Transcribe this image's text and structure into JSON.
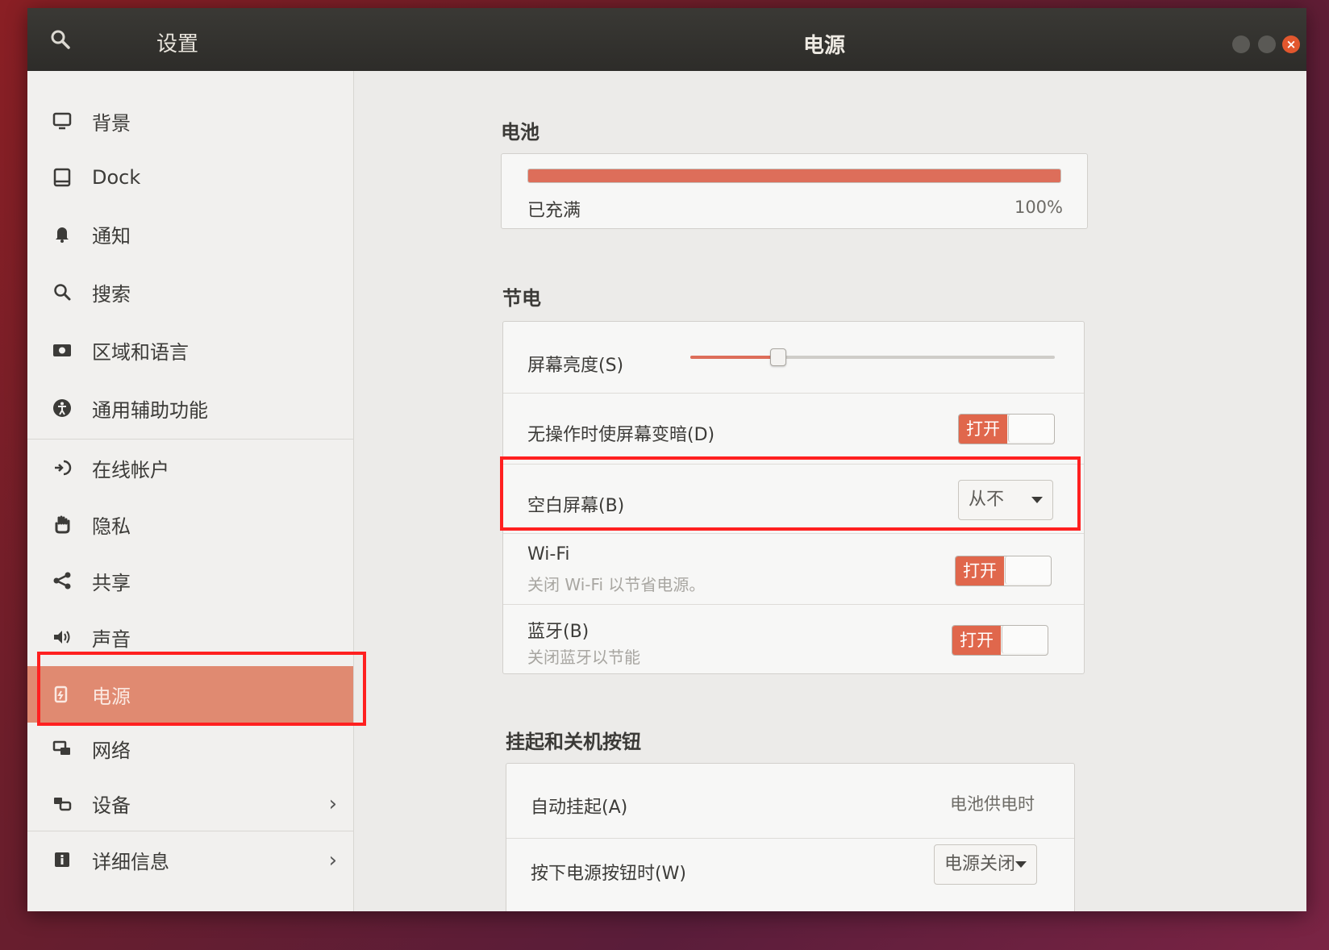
{
  "titlebar": {
    "search_icon": "search-icon",
    "left_title": "设置",
    "center_title": "电源"
  },
  "sidebar": {
    "items": [
      {
        "label": "背景",
        "icon": "display-icon"
      },
      {
        "label": "Dock",
        "icon": "dock-icon"
      },
      {
        "label": "通知",
        "icon": "bell-icon"
      },
      {
        "label": "搜索",
        "icon": "search-icon"
      },
      {
        "label": "区域和语言",
        "icon": "camera-icon"
      },
      {
        "label": "通用辅助功能",
        "icon": "accessibility-icon"
      },
      {
        "label": "在线帐户",
        "icon": "online-accounts-icon"
      },
      {
        "label": "隐私",
        "icon": "hand-icon"
      },
      {
        "label": "共享",
        "icon": "share-icon"
      },
      {
        "label": "声音",
        "icon": "speaker-icon"
      },
      {
        "label": "电源",
        "icon": "power-icon",
        "active": true
      },
      {
        "label": "网络",
        "icon": "network-icon"
      },
      {
        "label": "设备",
        "icon": "devices-icon",
        "chevron": "›"
      },
      {
        "label": "详细信息",
        "icon": "info-icon",
        "chevron": "›"
      }
    ]
  },
  "battery": {
    "section_title": "电池",
    "status": "已充满",
    "percent_text": "100%",
    "level": 1.0,
    "fill_color": "#dd6e5a"
  },
  "power_saving": {
    "section_title": "节电",
    "brightness_label": "屏幕亮度(S)",
    "brightness_level": 0.24,
    "dim_label": "无操作时使屏幕变暗(D)",
    "dim_toggle": "打开",
    "blank_label": "空白屏幕(B)",
    "blank_value": "从不",
    "wifi_label": "Wi-Fi",
    "wifi_sub": "关闭 Wi-Fi 以节省电源。",
    "wifi_toggle": "打开",
    "bt_label": "蓝牙(B)",
    "bt_sub": "关闭蓝牙以节能",
    "bt_toggle": "打开"
  },
  "suspend": {
    "section_title": "挂起和关机按钮",
    "auto_label": "自动挂起(A)",
    "auto_value": "电池供电时",
    "button_label": "按下电源按钮时(W)",
    "button_value": "电源关闭"
  },
  "colors": {
    "accent": "#e0674c",
    "highlight_box": "#ff2020"
  }
}
